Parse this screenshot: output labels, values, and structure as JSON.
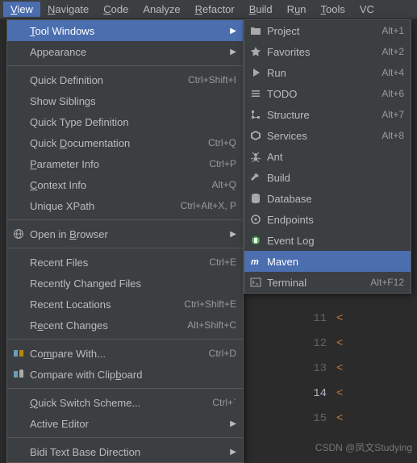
{
  "menubar": {
    "items": [
      {
        "label": "View",
        "u": "V",
        "active": true
      },
      {
        "label": "Navigate",
        "u": "N"
      },
      {
        "label": "Code",
        "u": "C"
      },
      {
        "label": "Analyze"
      },
      {
        "label": "Refactor",
        "u": "R"
      },
      {
        "label": "Build",
        "u": "B"
      },
      {
        "label": "Run",
        "u": "u"
      },
      {
        "label": "Tools",
        "u": "T"
      },
      {
        "label": "VC"
      }
    ]
  },
  "primary_menu": [
    {
      "type": "item",
      "label": "Tool Windows",
      "u": "T",
      "submenu": true,
      "highlighted": true
    },
    {
      "type": "item",
      "label": "Appearance",
      "submenu": true
    },
    {
      "type": "sep"
    },
    {
      "type": "item",
      "label": "Quick Definition",
      "shortcut": "Ctrl+Shift+I"
    },
    {
      "type": "item",
      "label": "Show Siblings"
    },
    {
      "type": "item",
      "label": "Quick Type Definition"
    },
    {
      "type": "item",
      "label": "Quick Documentation",
      "u": "D",
      "shortcut": "Ctrl+Q"
    },
    {
      "type": "item",
      "label": "Parameter Info",
      "u": "P",
      "shortcut": "Ctrl+P"
    },
    {
      "type": "item",
      "label": "Context Info",
      "u": "C",
      "shortcut": "Alt+Q"
    },
    {
      "type": "item",
      "label": "Unique XPath",
      "shortcut": "Ctrl+Alt+X, P"
    },
    {
      "type": "sep"
    },
    {
      "type": "item",
      "label": "Open in Browser",
      "u": "B",
      "icon": "globe",
      "submenu": true
    },
    {
      "type": "sep"
    },
    {
      "type": "item",
      "label": "Recent Files",
      "shortcut": "Ctrl+E"
    },
    {
      "type": "item",
      "label": "Recently Changed Files"
    },
    {
      "type": "item",
      "label": "Recent Locations",
      "shortcut": "Ctrl+Shift+E"
    },
    {
      "type": "item",
      "label": "Recent Changes",
      "u": "e",
      "shortcut": "Alt+Shift+C"
    },
    {
      "type": "sep"
    },
    {
      "type": "item",
      "label": "Compare With...",
      "u": "m",
      "icon": "compare",
      "shortcut": "Ctrl+D"
    },
    {
      "type": "item",
      "label": "Compare with Clipboard",
      "u": "b",
      "icon": "compare-clip"
    },
    {
      "type": "sep"
    },
    {
      "type": "item",
      "label": "Quick Switch Scheme...",
      "u": "Q",
      "shortcut": "Ctrl+`"
    },
    {
      "type": "item",
      "label": "Active Editor",
      "submenu": true
    },
    {
      "type": "sep"
    },
    {
      "type": "item",
      "label": "Bidi Text Base Direction",
      "submenu": true
    }
  ],
  "secondary_menu": [
    {
      "label": "Project",
      "icon": "folder",
      "shortcut": "Alt+1"
    },
    {
      "label": "Favorites",
      "icon": "star",
      "shortcut": "Alt+2"
    },
    {
      "label": "Run",
      "icon": "play",
      "shortcut": "Alt+4"
    },
    {
      "label": "TODO",
      "icon": "todo",
      "shortcut": "Alt+6"
    },
    {
      "label": "Structure",
      "icon": "structure",
      "shortcut": "Alt+7"
    },
    {
      "label": "Services",
      "icon": "services",
      "shortcut": "Alt+8"
    },
    {
      "label": "Ant",
      "icon": "ant"
    },
    {
      "label": "Build",
      "icon": "hammer"
    },
    {
      "label": "Database",
      "icon": "database"
    },
    {
      "label": "Endpoints",
      "icon": "endpoints"
    },
    {
      "label": "Event Log",
      "icon": "eventlog"
    },
    {
      "label": "Maven",
      "icon": "maven",
      "highlighted": true
    },
    {
      "label": "Terminal",
      "icon": "terminal",
      "shortcut": "Alt+F12"
    }
  ],
  "editor": {
    "lines": [
      "11",
      "12",
      "13",
      "14",
      "15"
    ],
    "current": "14"
  },
  "watermark": "CSDN @凤文Studying"
}
